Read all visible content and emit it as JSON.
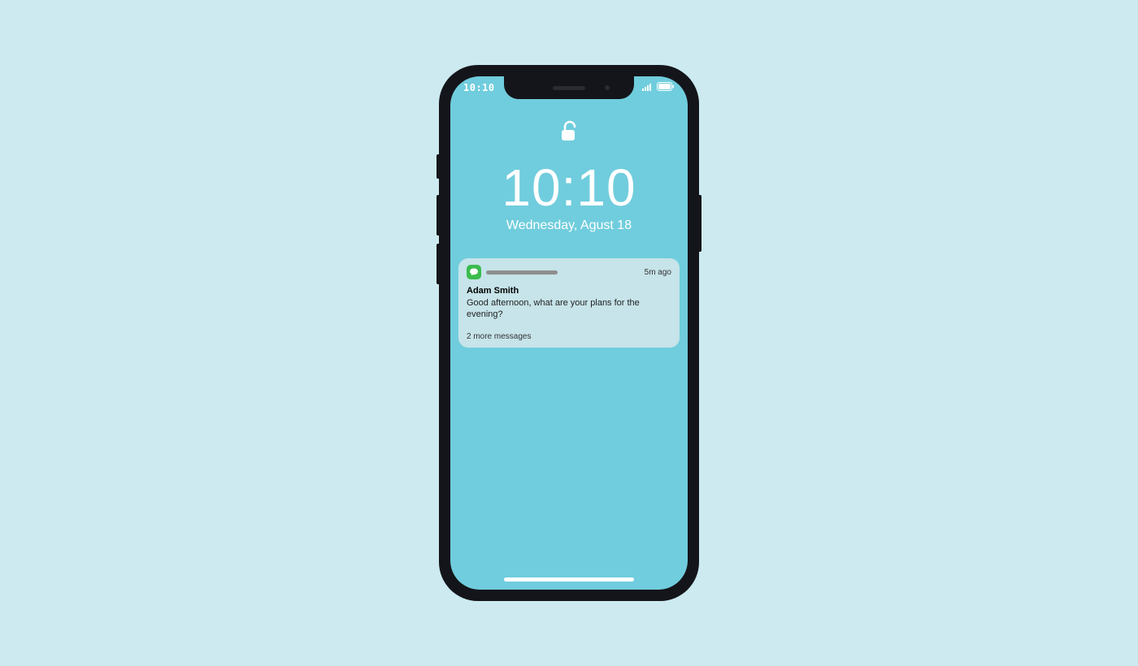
{
  "status": {
    "time": "10:10"
  },
  "lockscreen": {
    "time": "10:10",
    "date": "Wednesday, Agust 18"
  },
  "notification": {
    "time": "5m ago",
    "sender": "Adam Smith",
    "body": "Good afternoon, what are your plans for the evening?",
    "more": "2 more messages"
  }
}
